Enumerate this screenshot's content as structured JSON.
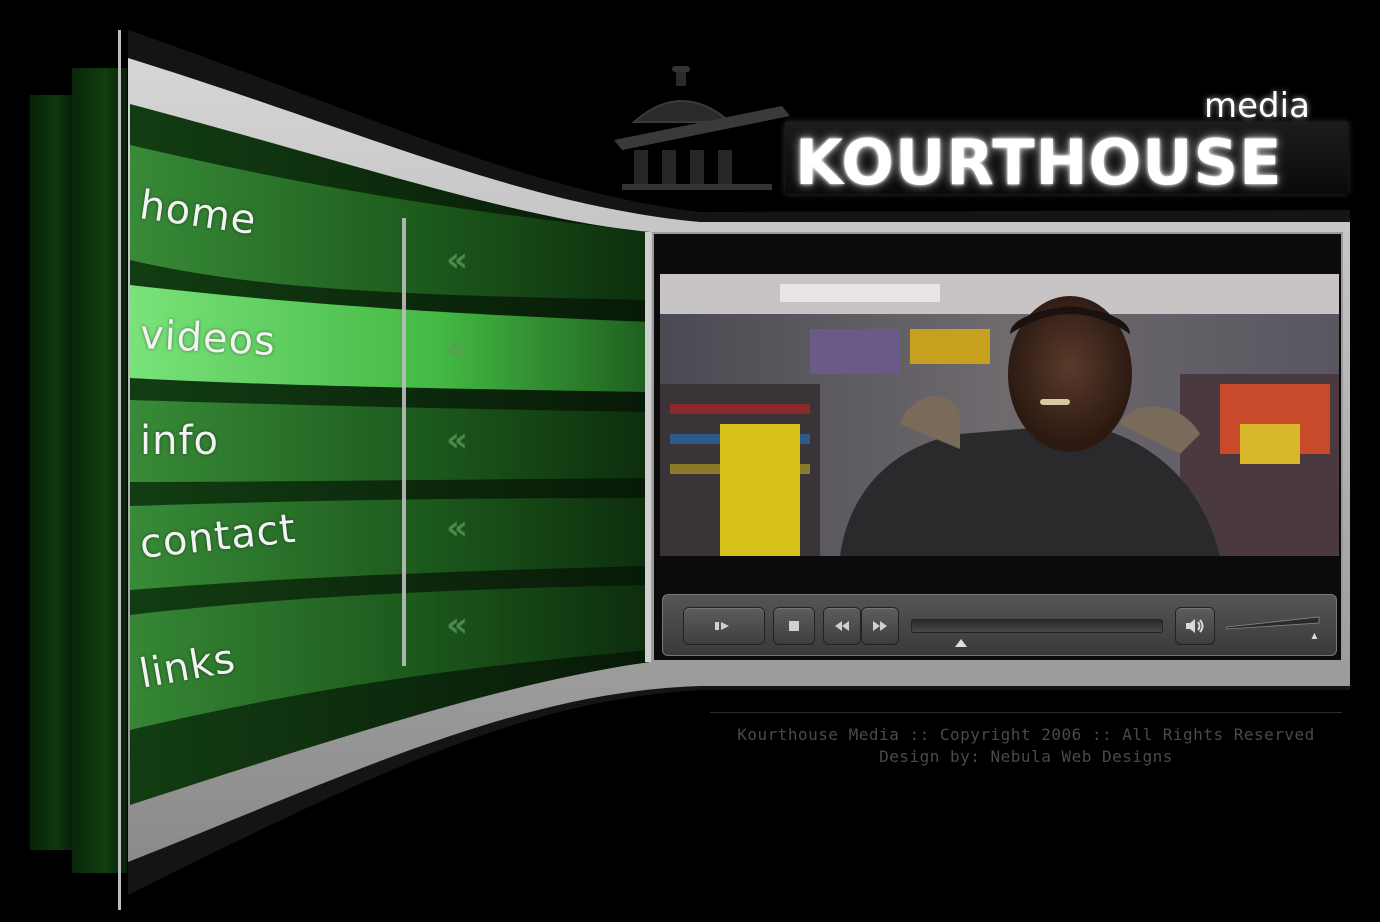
{
  "brand": {
    "word": "KOURTHOUSE",
    "tag": "media"
  },
  "nav": {
    "items": [
      {
        "label": "home",
        "active": false
      },
      {
        "label": "videos",
        "active": true
      },
      {
        "label": "info",
        "active": false
      },
      {
        "label": "contact",
        "active": false
      },
      {
        "label": "links",
        "active": false
      }
    ],
    "chevron": "«"
  },
  "player": {
    "controls": {
      "play_icon": "play-icon",
      "stop_icon": "stop-icon",
      "rewind_icon": "rewind-icon",
      "forward_icon": "fast-forward-icon",
      "volume_icon": "speaker-icon"
    },
    "seek_position": 0.2,
    "volume_level": 0.95
  },
  "footer": {
    "line1": "Kourthouse Media :: Copyright 2006 :: All Rights Reserved",
    "line2": "Design by: Nebula Web Designs"
  },
  "colors": {
    "background": "#000000",
    "green_dark": "#0f3d0f",
    "green_mid": "#2a7a2a",
    "green_active": "#5fd25f",
    "frame_gray": "#b8b8b8"
  }
}
